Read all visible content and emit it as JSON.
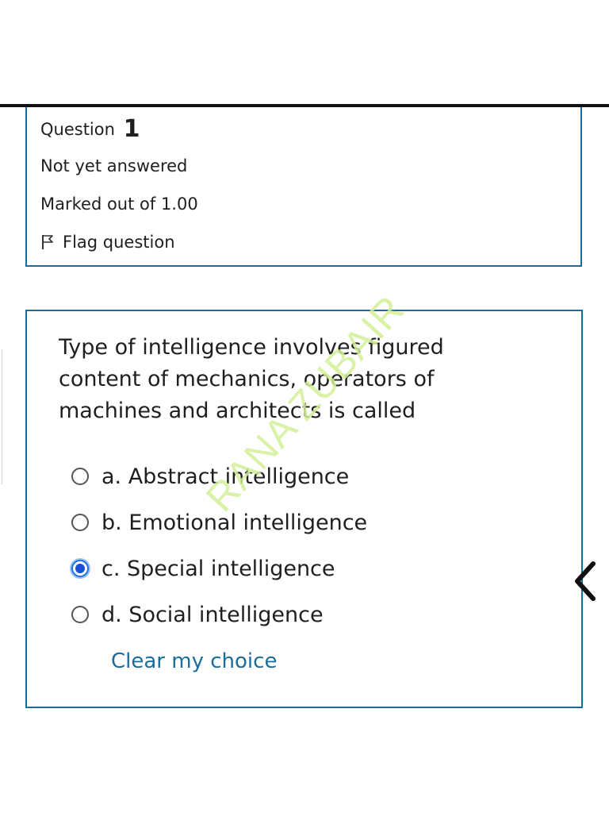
{
  "question_info": {
    "label": "Question",
    "number": "1",
    "status": "Not yet answered",
    "marks": "Marked out of 1.00",
    "flag_label": "Flag question",
    "flag_icon": "flag-icon"
  },
  "question": {
    "text": "Type of intelligence involves figured content of mechanics, operators of machines and architects is called",
    "options": [
      {
        "label": "a. Abstract intelligence",
        "selected": false
      },
      {
        "label": "b. Emotional intelligence",
        "selected": false
      },
      {
        "label": "c. Special intelligence",
        "selected": true
      },
      {
        "label": "d. Social intelligence",
        "selected": false
      }
    ],
    "clear_label": "Clear my choice"
  },
  "watermark": "RANA ZUBAIR",
  "navigation": {
    "back_icon": "chevron-left-icon"
  },
  "colors": {
    "border": "#1a6d9b",
    "link": "#1a6d9b",
    "selected_radio": "#1a4fd6",
    "watermark": "#d4f09a"
  }
}
